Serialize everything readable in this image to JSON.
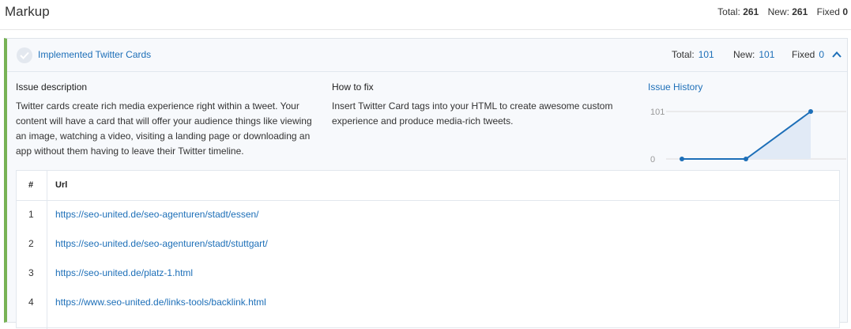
{
  "page": {
    "title": "Markup",
    "stats": [
      {
        "label": "Total:",
        "value": "261"
      },
      {
        "label": "New:",
        "value": "261"
      },
      {
        "label": "Fixed",
        "value": "0"
      }
    ]
  },
  "issue": {
    "name": "Implemented Twitter Cards",
    "total_label": "Total:",
    "total": "101",
    "new_label": "New:",
    "new": "101",
    "fixed_label": "Fixed",
    "fixed": "0",
    "accent_color": "#77b255",
    "link_color": "#1d6fb8",
    "description_title": "Issue description",
    "description_lines": [
      "Twitter cards create rich media experience right within a tweet. Your",
      "content will have a card that will offer your audience things like viewing",
      "an image, watching a video, visiting a landing page or downloading an",
      "app without them having to leave their Twitter timeline."
    ],
    "howto_title": "How to fix",
    "howto_lines": [
      "Insert Twitter Card tags into your HTML to create awesome custom",
      "experience and produce media-rich tweets."
    ],
    "history_title": "Issue History"
  },
  "chart_data": {
    "type": "area",
    "y_ticks": [
      "101",
      "0"
    ],
    "ylim": [
      0,
      101
    ],
    "values": [
      0,
      0,
      101
    ]
  },
  "table": {
    "headers": {
      "num": "#",
      "url": "Url"
    },
    "rows": [
      {
        "num": "1",
        "url": "https://seo-united.de/seo-agenturen/stadt/essen/"
      },
      {
        "num": "2",
        "url": "https://seo-united.de/seo-agenturen/stadt/stuttgart/"
      },
      {
        "num": "3",
        "url": "https://seo-united.de/platz-1.html"
      },
      {
        "num": "4",
        "url": "https://www.seo-united.de/links-tools/backlink.html"
      }
    ]
  }
}
